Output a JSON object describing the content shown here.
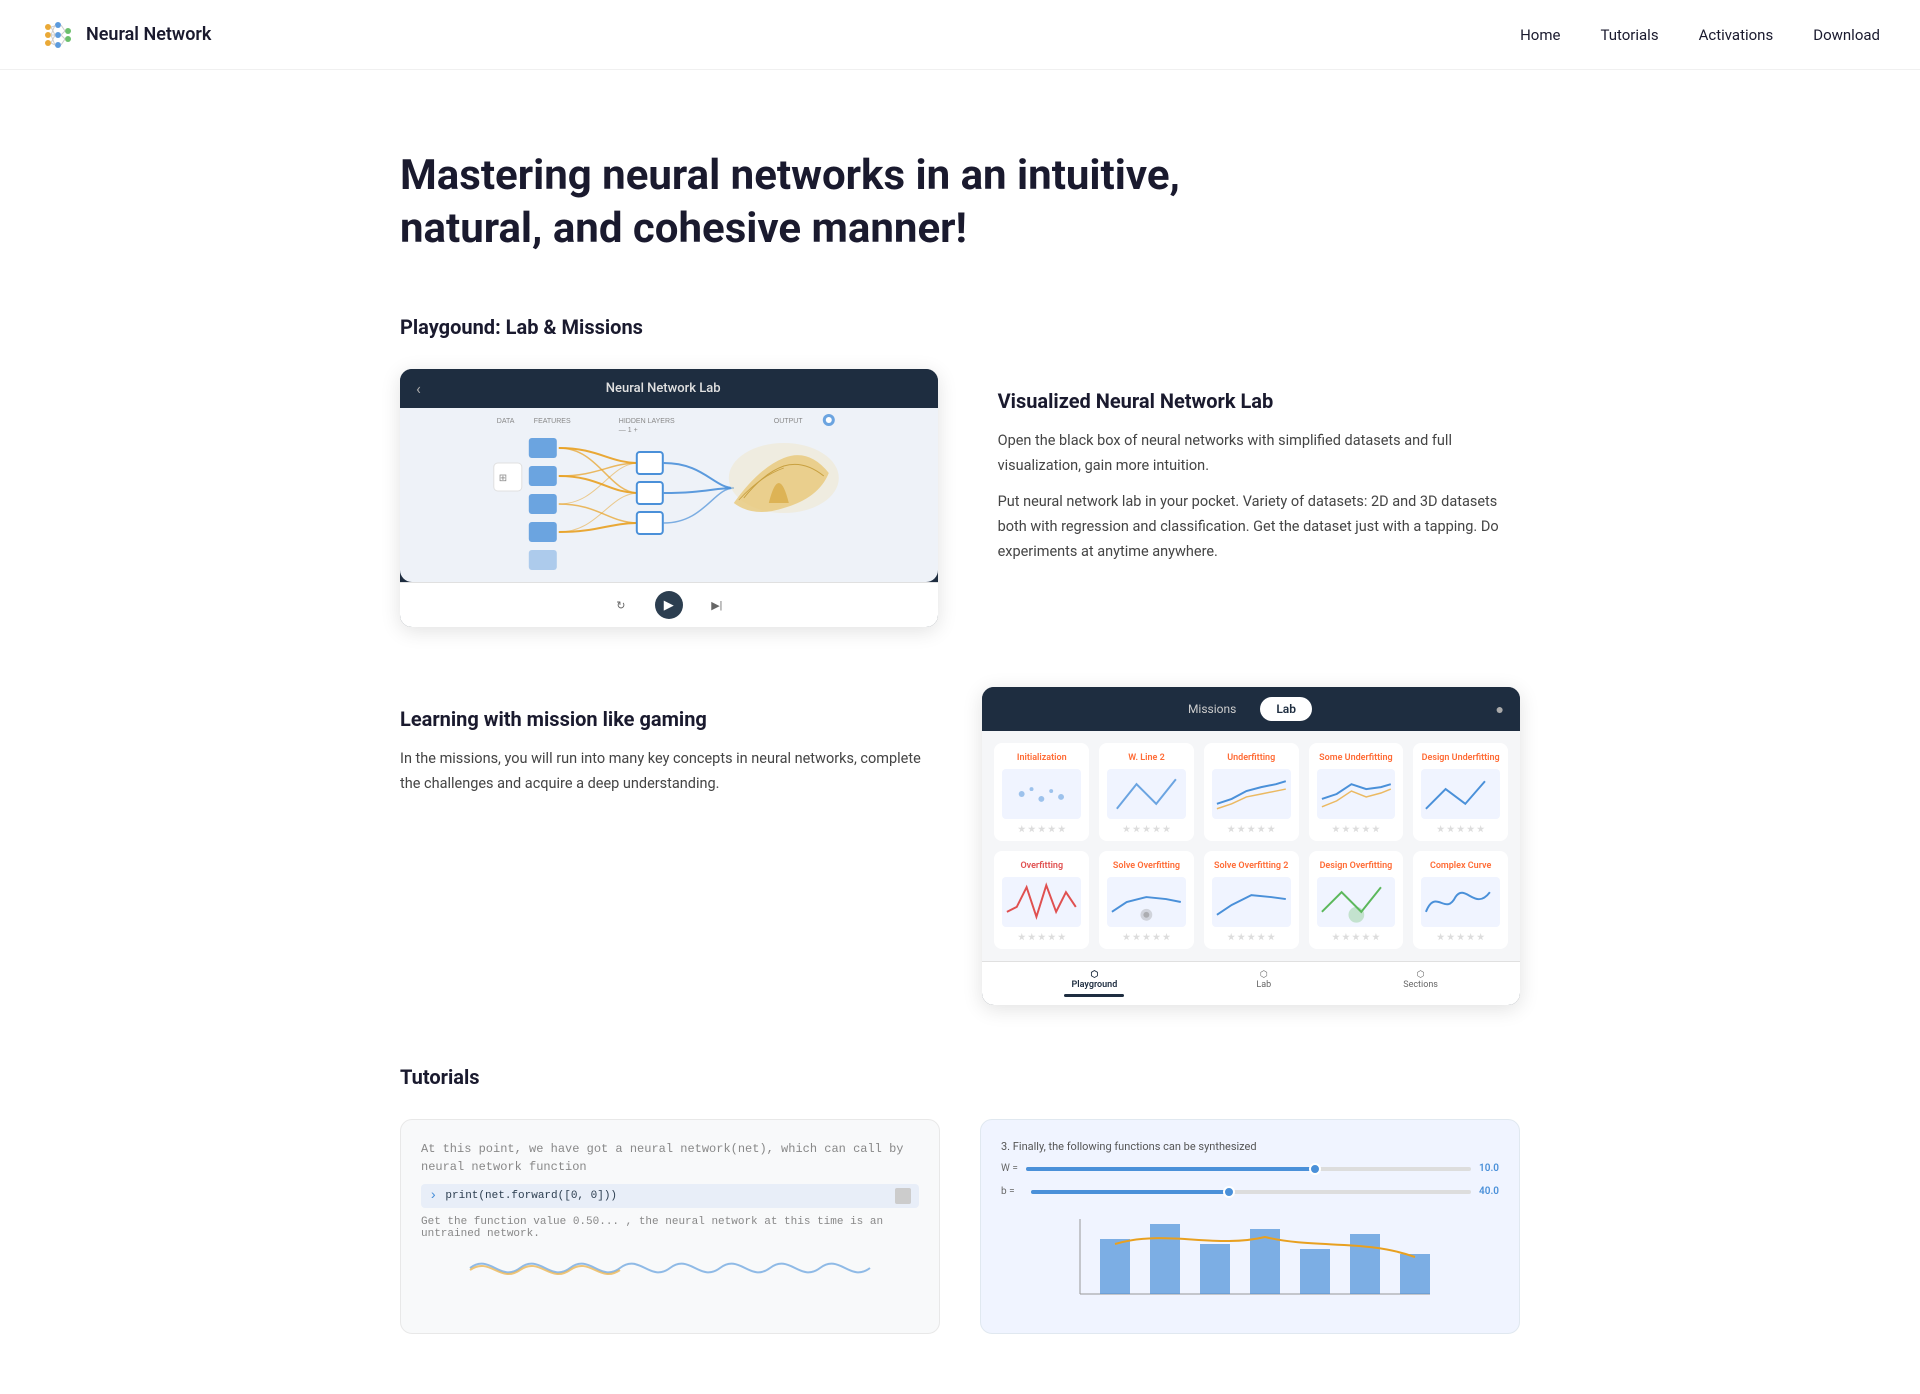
{
  "brand": {
    "name": "Neural Network",
    "logo_alt": "neural-network-logo"
  },
  "navbar": {
    "links": [
      {
        "label": "Home",
        "id": "home"
      },
      {
        "label": "Tutorials",
        "id": "tutorials"
      },
      {
        "label": "Activations",
        "id": "activations"
      },
      {
        "label": "Download",
        "id": "download"
      }
    ]
  },
  "hero": {
    "title": "Mastering neural networks in an intuitive, natural, and cohesive manner!"
  },
  "playground_section": {
    "title": "Playgound: Lab & Missions",
    "lab_feature": {
      "heading": "Visualized Neural Network Lab",
      "description1": "Open the black box of neural networks with simplified datasets and full visualization, gain more intuition.",
      "description2": "Put neural network lab in your pocket. Variety of datasets: 2D and 3D datasets both with regression and classification. Get the dataset just with a tapping. Do experiments at anytime anywhere.",
      "mockup_title": "Neural Network Lab"
    },
    "missions_feature": {
      "heading": "Learning with mission like gaming",
      "description": "In the missions, you will run into many key concepts in neural networks, complete the challenges and acquire a deep understanding.",
      "missions_tab": "Missions",
      "lab_tab": "Lab",
      "mission_cards": [
        {
          "title": "Initialization",
          "stars": 5
        },
        {
          "title": "W, Line 2",
          "stars": 5
        },
        {
          "title": "Underfitting",
          "stars": 5
        },
        {
          "title": "Some Underfitting",
          "stars": 5
        },
        {
          "title": "Design Underfitting",
          "stars": 5
        },
        {
          "title": "Overfitting",
          "stars": 5
        },
        {
          "title": "Solve Overfitting",
          "stars": 5
        },
        {
          "title": "Solve Overfitting 2",
          "stars": 5
        },
        {
          "title": "Design Overfitting",
          "stars": 5
        },
        {
          "title": "Complex Curve",
          "stars": 5
        }
      ],
      "bottom_nav": [
        {
          "label": "Playground",
          "active": true
        },
        {
          "label": "Lab",
          "active": false
        },
        {
          "label": "Sections",
          "active": false
        }
      ]
    }
  },
  "tutorials_section": {
    "title": "Tutorials",
    "code_mockup": {
      "line1": "At this point, we have got a neural network(net), which can call by neural network function",
      "code": "print(net.forward([0, 0]))",
      "result": "Get the function value 0.50... , the neural network at this time is an untrained network."
    },
    "chart_mockup": {
      "title": "3. Finally, the following functions can be synthesized",
      "slider1_label": "W =",
      "slider1_value": "10.0",
      "slider1_pct": 65,
      "slider2_label": "b =",
      "slider2_value": "40.0",
      "slider2_pct": 45
    }
  }
}
